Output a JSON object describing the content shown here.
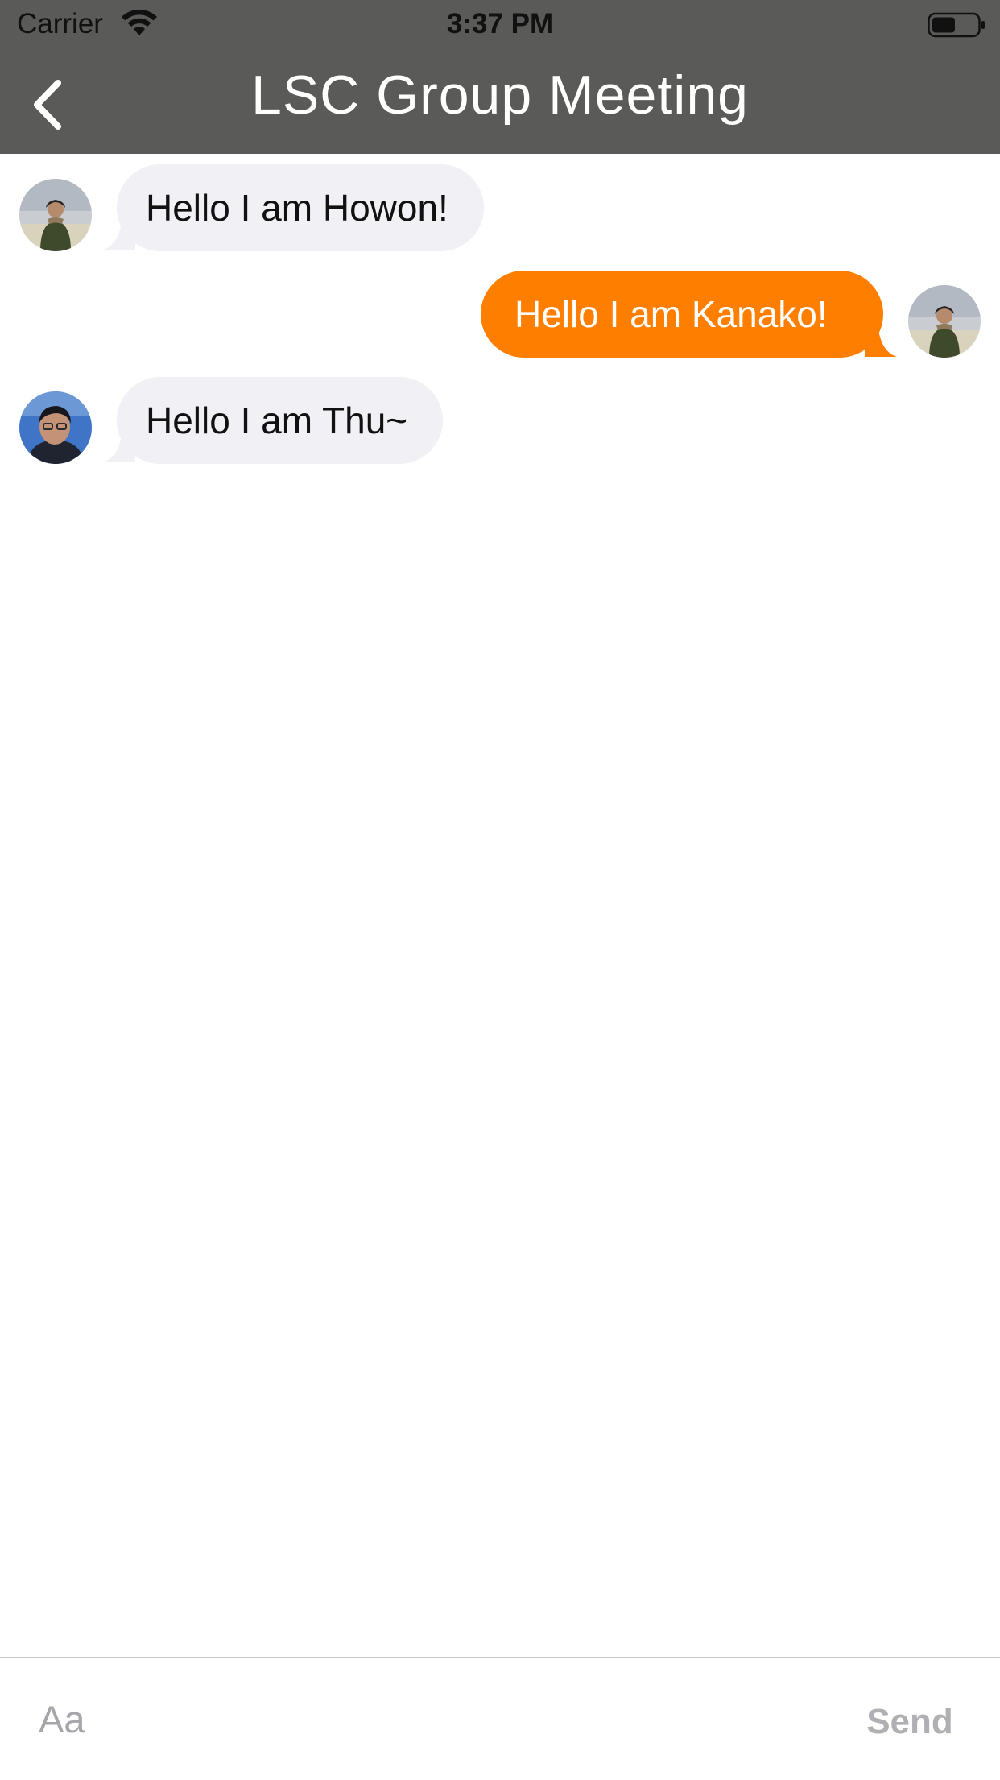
{
  "status_bar": {
    "carrier": "Carrier",
    "time": "3:37 PM",
    "wifi_icon": "wifi-icon",
    "battery_icon": "battery-icon"
  },
  "nav": {
    "back_icon": "chevron-left-icon",
    "title": "LSC Group Meeting",
    "background_color": "#5a5a58"
  },
  "messages": [
    {
      "direction": "incoming",
      "text": "Hello I am Howon!",
      "avatar": "avatar-howon"
    },
    {
      "direction": "outgoing",
      "text": "Hello I am Kanako!",
      "avatar": "avatar-kanako"
    },
    {
      "direction": "incoming",
      "text": "Hello I am Thu~",
      "avatar": "avatar-thu"
    }
  ],
  "colors": {
    "incoming_bubble": "#f0f0f5",
    "outgoing_bubble": "#fe7f00",
    "send_disabled": "#b0b0b4"
  },
  "input": {
    "placeholder": "Aa",
    "value": "",
    "send_label": "Send"
  }
}
